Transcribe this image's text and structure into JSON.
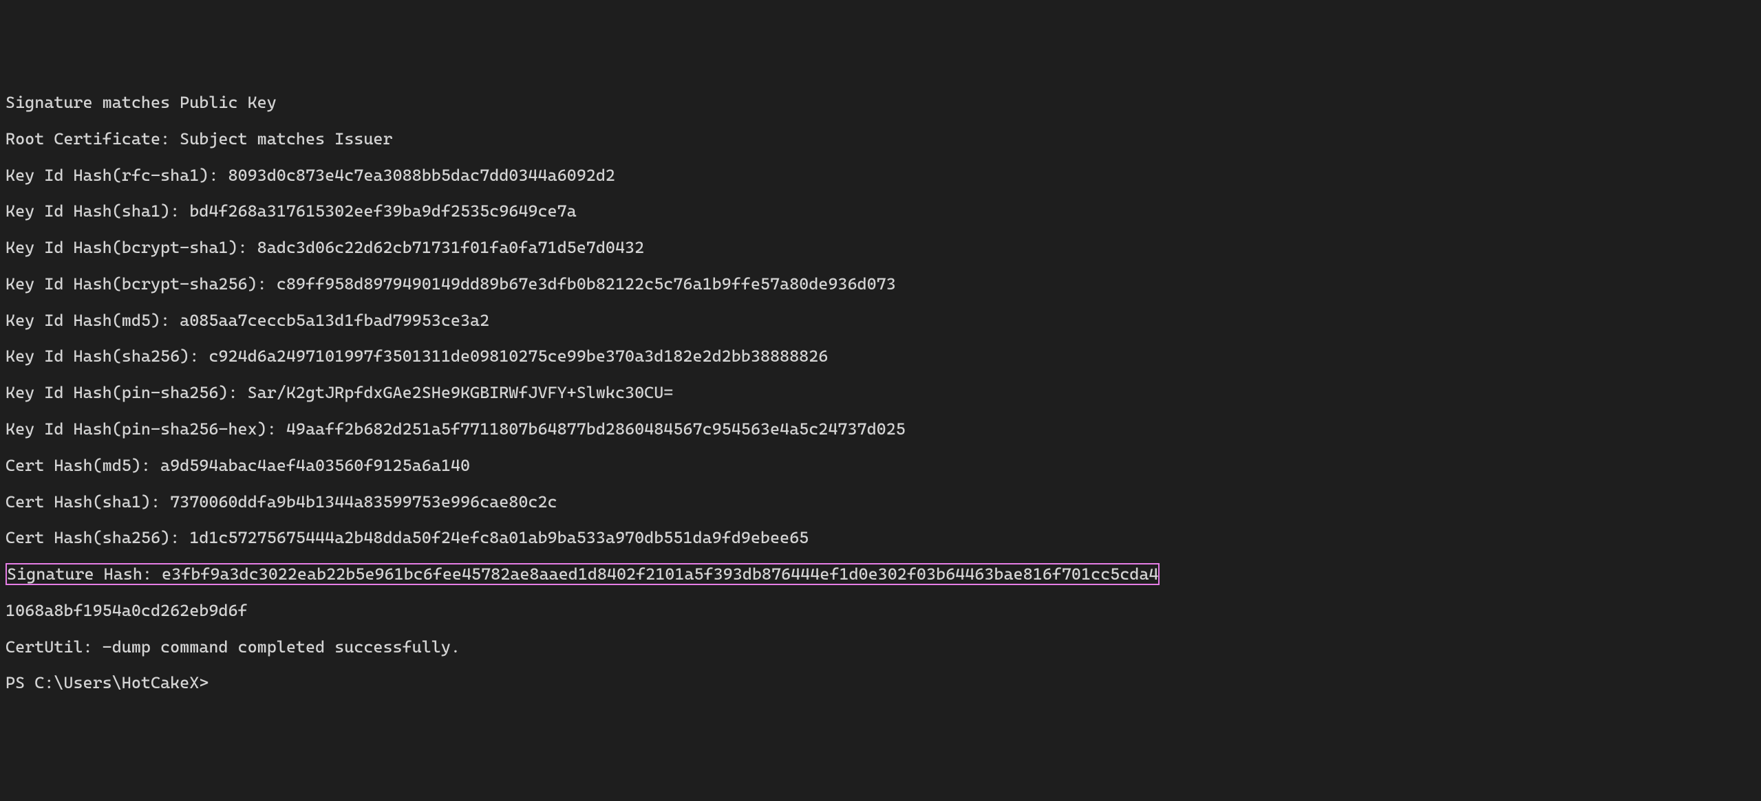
{
  "terminal": {
    "lines": [
      "Signature matches Public Key",
      "Root Certificate: Subject matches Issuer",
      "Key Id Hash(rfc-sha1): 8093d0c873e4c7ea3088bb5dac7dd0344a6092d2",
      "Key Id Hash(sha1): bd4f268a317615302eef39ba9df2535c9649ce7a",
      "Key Id Hash(bcrypt-sha1): 8adc3d06c22d62cb71731f01fa0fa71d5e7d0432",
      "Key Id Hash(bcrypt-sha256): c89ff958d8979490149dd89b67e3dfb0b82122c5c76a1b9ffe57a80de936d073",
      "Key Id Hash(md5): a085aa7ceccb5a13d1fbad79953ce3a2",
      "Key Id Hash(sha256): c924d6a2497101997f3501311de09810275ce99be370a3d182e2d2bb38888826",
      "Key Id Hash(pin-sha256): Sar/K2gtJRpfdxGAe2SHe9KGBIRWfJVFY+Slwkc30CU=",
      "Key Id Hash(pin-sha256-hex): 49aaff2b682d251a5f7711807b64877bd2860484567c954563e4a5c24737d025",
      "Cert Hash(md5): a9d594abac4aef4a03560f9125a6a140",
      "Cert Hash(sha1): 7370060ddfa9b4b1344a83599753e996cae80c2c",
      "Cert Hash(sha256): 1d1c57275675444a2b48dda50f24efc8a01ab9ba533a970db551da9fd9ebee65"
    ],
    "highlighted_line": "Signature Hash: e3fbf9a3dc3022eab22b5e961bc6fee45782ae8aaed1d8402f2101a5f393db876444ef1d0e302f03b64463bae816f701cc5cda4",
    "post_highlight_lines": [
      "1068a8bf1954a0cd262eb9d6f",
      "CertUtil: -dump command completed successfully."
    ],
    "prompt": "PS C:\\Users\\HotCakeX>"
  }
}
